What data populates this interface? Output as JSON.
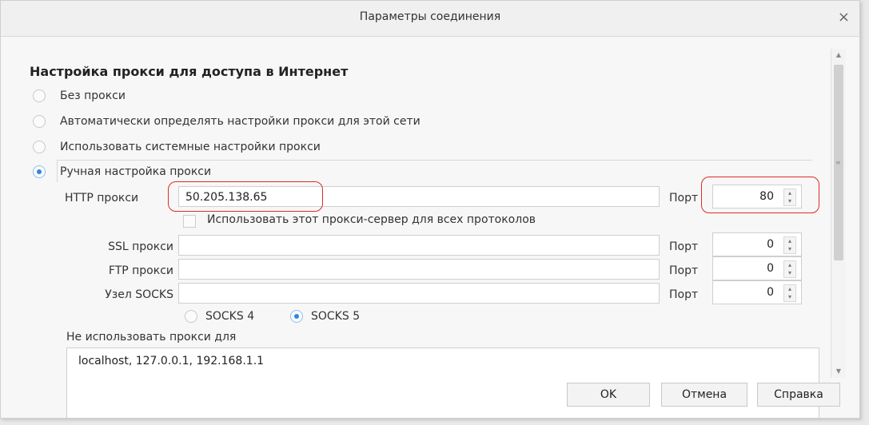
{
  "window": {
    "title": "Параметры соединения",
    "close_glyph": "×"
  },
  "section_title": "Настройка прокси для доступа в Интернет",
  "options": [
    {
      "label": "Без прокси",
      "selected": false
    },
    {
      "label": "Автоматически определять настройки прокси для этой сети",
      "selected": false
    },
    {
      "label": "Использовать системные настройки прокси",
      "selected": false
    },
    {
      "label": "Ручная настройка прокси",
      "selected": true
    }
  ],
  "http": {
    "label": "HTTP прокси",
    "value": "50.205.138.65",
    "port_label": "Порт",
    "port": "80"
  },
  "use_for_all": {
    "label": "Использовать этот прокси-сервер для всех протоколов",
    "checked": false
  },
  "ssl": {
    "label": "SSL прокси",
    "value": "",
    "port_label": "Порт",
    "port": "0"
  },
  "ftp": {
    "label": "FTP прокси",
    "value": "",
    "port_label": "Порт",
    "port": "0"
  },
  "socks": {
    "label": "Узел SOCKS",
    "value": "",
    "port_label": "Порт",
    "port": "0"
  },
  "socks_versions": [
    {
      "label": "SOCKS 4",
      "selected": false
    },
    {
      "label": "SOCKS 5",
      "selected": true
    }
  ],
  "no_proxy": {
    "label": "Не использовать прокси для",
    "value": "localhost, 127.0.0.1, 192.168.1.1"
  },
  "buttons": {
    "ok": "OK",
    "cancel": "Отмена",
    "help": "Справка"
  },
  "colors": {
    "accent": "#2b8ae2",
    "annotation": "#e02a2a"
  }
}
